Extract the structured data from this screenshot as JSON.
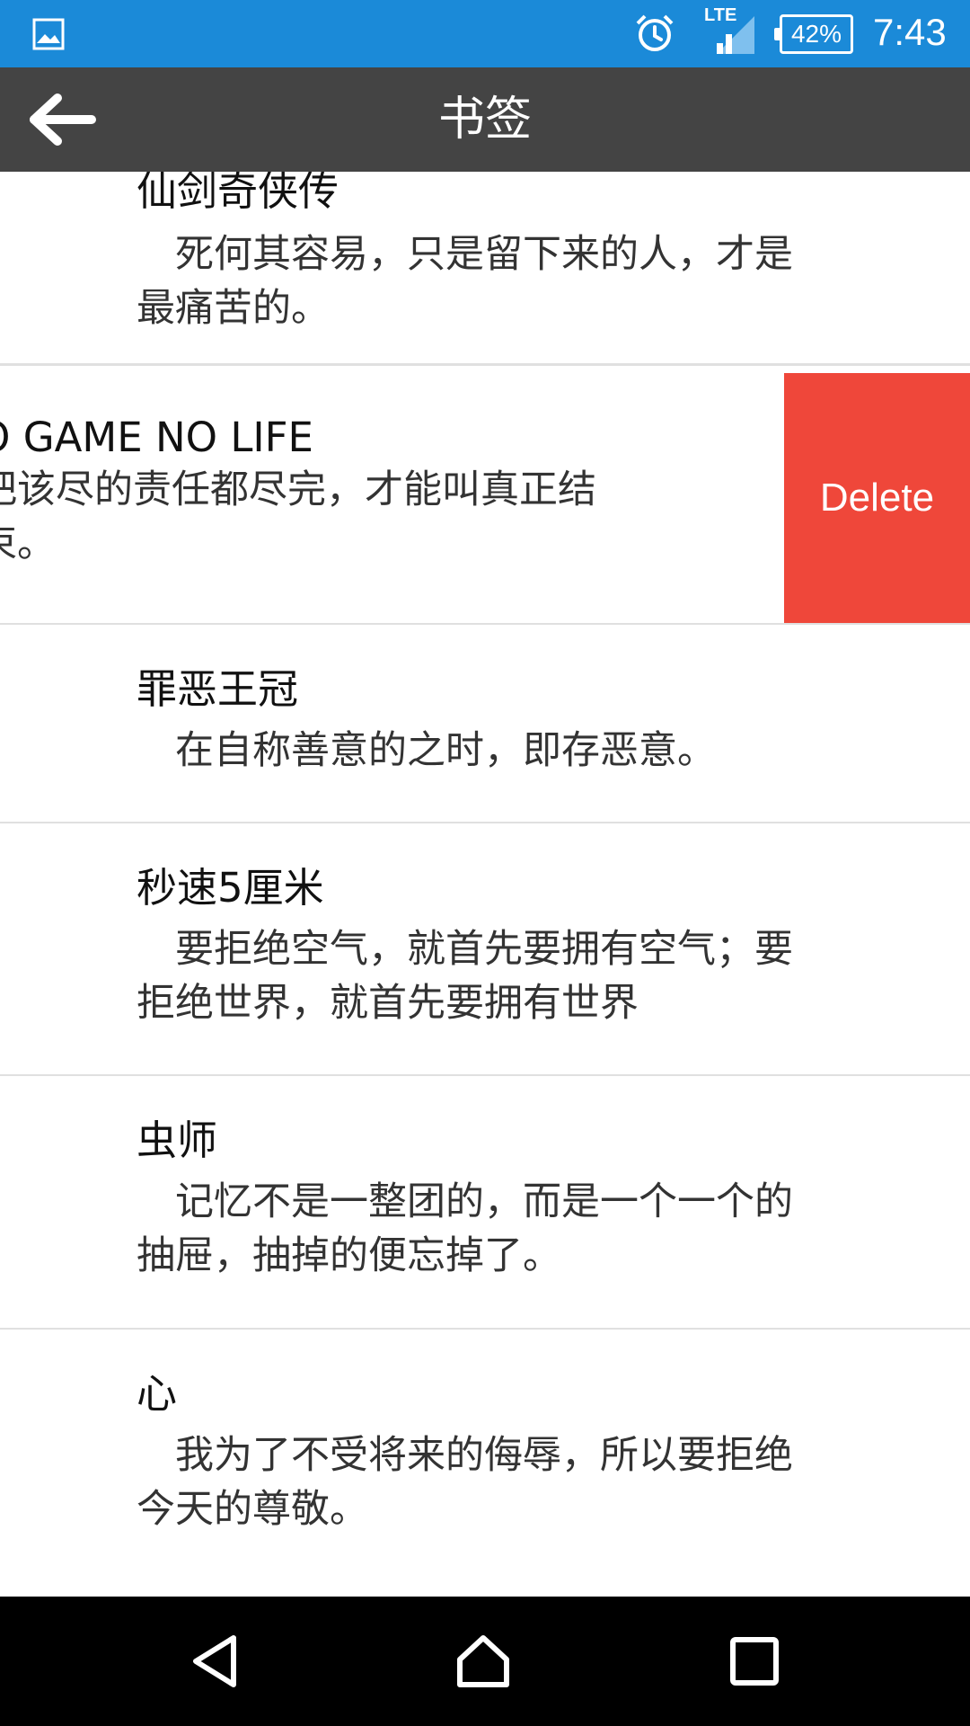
{
  "status_bar": {
    "network": "LTE",
    "battery": "42%",
    "time": "7:43",
    "icons": [
      "gallery-icon",
      "alarm-icon",
      "signal-icon",
      "battery-icon"
    ]
  },
  "toolbar": {
    "title": "书签",
    "back_icon": "arrow-left-icon"
  },
  "bookmarks": [
    {
      "title": "仙剑奇侠传",
      "text": "　死何其容易，只是留下来的人，才是最痛苦的。"
    },
    {
      "title": "O GAME NO LIFE",
      "text": "把该尽的责任都尽完，才能叫真正结束。",
      "swiped": true,
      "action": "Delete"
    },
    {
      "title": "罪恶王冠",
      "text": "　在自称善意的之时，即存恶意。"
    },
    {
      "title": "秒速5厘米",
      "text": "　要拒绝空气，就首先要拥有空气；要拒绝世界，就首先要拥有世界"
    },
    {
      "title": "虫师",
      "text": "　记忆不是一整团的，而是一个一个的抽屉，抽掉的便忘掉了。"
    },
    {
      "title": "心",
      "text": "　我为了不受将来的侮辱，所以要拒绝今天的尊敬。"
    }
  ],
  "nav_bar": {
    "icons": [
      "back-triangle-icon",
      "home-icon",
      "recents-icon"
    ]
  },
  "colors": {
    "status_bar": "#1b8ad8",
    "toolbar": "#444444",
    "delete": "#ef473a",
    "nav_bar": "#000000"
  }
}
